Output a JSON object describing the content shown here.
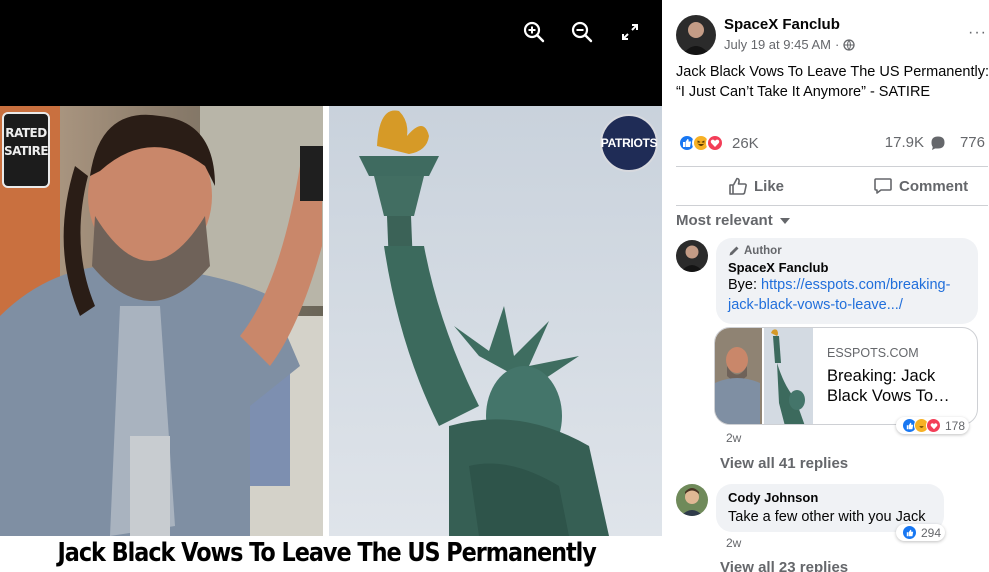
{
  "viewer": {
    "toolbar": {
      "zoom_in": "zoom-in-icon",
      "zoom_out": "zoom-out-icon",
      "fullscreen": "fullscreen-icon"
    },
    "image": {
      "rated_badge": "RATED SATIRE",
      "logo_text": "PATRIOTS",
      "caption": "Jack Black Vows To Leave The US Permanently"
    }
  },
  "post": {
    "author": "SpaceX Fanclub",
    "timestamp": "July 19 at 9:45 AM",
    "separator": "·",
    "privacy_icon": "globe-icon",
    "more_label": "···",
    "text_line1": "Jack Black Vows To Leave The US Permanently:",
    "text_line2": "“I Just Can’t Take It Anymore” - SATIRE",
    "reactions_count": "26K",
    "comments_count": "17.9K",
    "shares_count": "776",
    "like_label": "Like",
    "comment_label": "Comment",
    "sort_label": "Most relevant"
  },
  "comments": [
    {
      "badge": "Author",
      "name": "SpaceX Fanclub",
      "text_prefix": "Bye: ",
      "link_line1": "https://esspots.com/breaking-",
      "link_line2": "jack-black-vows-to-leave.../",
      "card_domain": "ESSPOTS.COM",
      "card_title": "Breaking: Jack Black Vows To…",
      "reaction_count": "178",
      "time": "2w",
      "view_replies": "View all 41 replies"
    },
    {
      "name": "Cody Johnson",
      "text": "Take a few other with you Jack",
      "reaction_count": "294",
      "time": "2w",
      "view_replies": "View all 23 replies"
    }
  ],
  "colors": {
    "like_blue": "#1877f2",
    "love_red": "#f33e58",
    "haha_yellow": "#f7b125",
    "link_blue": "#216fdb",
    "meta_gray": "#65676b"
  }
}
